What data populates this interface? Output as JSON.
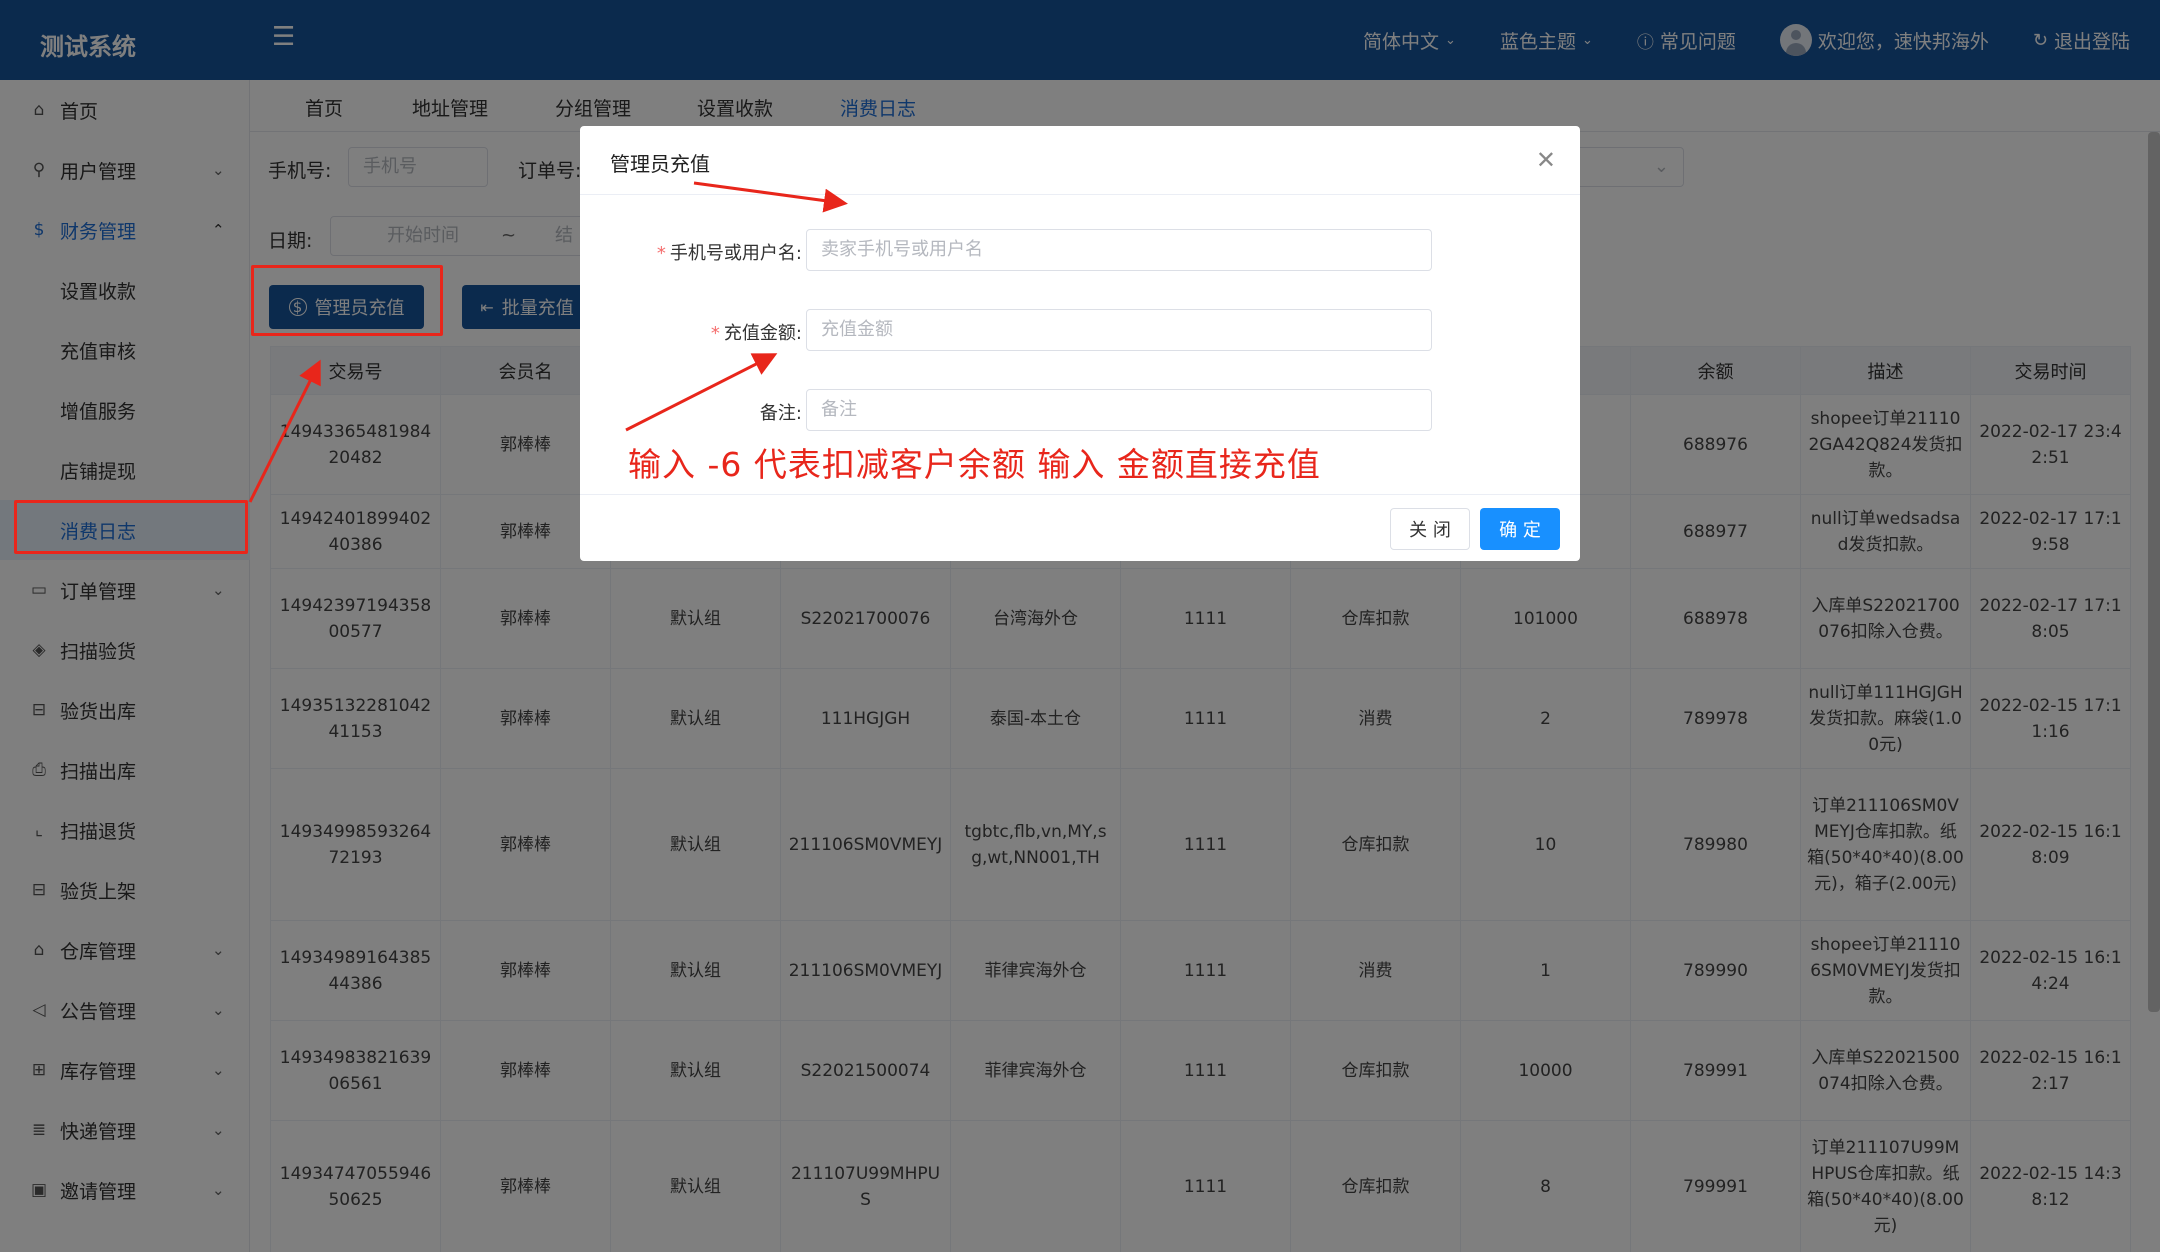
{
  "app": {
    "title": "测试系统"
  },
  "header": {
    "language": "简体中文",
    "theme": "蓝色主题",
    "faq": "常见问题",
    "welcome": "欢迎您，速快邦海外",
    "logout": "退出登陆"
  },
  "sidebar": {
    "items": [
      {
        "label": "首页",
        "icon": "home-icon"
      },
      {
        "label": "用户管理",
        "icon": "user-icon"
      },
      {
        "label": "财务管理",
        "icon": "dollar-icon"
      },
      {
        "label": "设置收款"
      },
      {
        "label": "充值审核"
      },
      {
        "label": "增值服务"
      },
      {
        "label": "店铺提现"
      },
      {
        "label": "消费日志"
      },
      {
        "label": "订单管理",
        "icon": "bag-icon"
      },
      {
        "label": "扫描验货",
        "icon": "shield-icon"
      },
      {
        "label": "验货出库",
        "icon": "scan-icon"
      },
      {
        "label": "扫描出库",
        "icon": "printer-icon"
      },
      {
        "label": "扫描退货",
        "icon": "return-icon"
      },
      {
        "label": "验货上架",
        "icon": "scan-icon"
      },
      {
        "label": "仓库管理",
        "icon": "bank-icon"
      },
      {
        "label": "公告管理",
        "icon": "megaphone-icon"
      },
      {
        "label": "库存管理",
        "icon": "grid-icon"
      },
      {
        "label": "快递管理",
        "icon": "list-icon"
      },
      {
        "label": "邀请管理",
        "icon": "ticket-icon"
      }
    ]
  },
  "tabs": [
    "首页",
    "地址管理",
    "分组管理",
    "设置收款",
    "消费日志"
  ],
  "filters": {
    "phone_label": "手机号:",
    "phone_placeholder": "手机号",
    "order_label": "订单号:",
    "date_label": "日期:",
    "date_start": "开始时间",
    "date_sep": "~",
    "date_end": "结"
  },
  "toolbar": {
    "admin_recharge": "管理员充值",
    "batch_recharge": "批量充值"
  },
  "table": {
    "headers": [
      "交易号",
      "会员名",
      "",
      "",
      "",
      "",
      "",
      "",
      "余额",
      "描述",
      "交易时间"
    ],
    "rows": [
      [
        "1494336548198420482",
        "郭棒棒",
        "",
        "",
        "",
        "",
        "",
        "",
        "688976",
        "shopee订单211102GA42Q824发货扣款。",
        "2022-02-17 23:42:51"
      ],
      [
        "1494240189940240386",
        "郭棒棒",
        "",
        "",
        "",
        "",
        "",
        "",
        "688977",
        "null订单wedsadsad发货扣款。",
        "2022-02-17 17:19:58"
      ],
      [
        "1494239719435800577",
        "郭棒棒",
        "默认组",
        "S22021700076",
        "台湾海外仓",
        "1111",
        "仓库扣款",
        "101000",
        "688978",
        "入库单S22021700076扣除入仓费。",
        "2022-02-17 17:18:05"
      ],
      [
        "1493513228104241153",
        "郭棒棒",
        "默认组",
        "111HGJGH",
        "泰国-本土仓",
        "1111",
        "消费",
        "2",
        "789978",
        "null订单111HGJGH发货扣款。麻袋(1.00元)",
        "2022-02-15 17:11:16"
      ],
      [
        "1493499859326472193",
        "郭棒棒",
        "默认组",
        "211106SM0VMEYJ",
        "tgbtc,flb,vn,MY,sg,wt,NN001,TH",
        "1111",
        "仓库扣款",
        "10",
        "789980",
        "订单211106SM0VMEYJ仓库扣款。纸箱(50*40*40)(8.00元)，箱子(2.00元)",
        "2022-02-15 16:18:09"
      ],
      [
        "1493498916438544386",
        "郭棒棒",
        "默认组",
        "211106SM0VMEYJ",
        "菲律宾海外仓",
        "1111",
        "消费",
        "1",
        "789990",
        "shopee订单211106SM0VMEYJ发货扣款。",
        "2022-02-15 16:14:24"
      ],
      [
        "1493498382163906561",
        "郭棒棒",
        "默认组",
        "S22021500074",
        "菲律宾海外仓",
        "1111",
        "仓库扣款",
        "10000",
        "789991",
        "入库单S22021500074扣除入仓费。",
        "2022-02-15 16:12:17"
      ],
      [
        "1493474705594650625",
        "郭棒棒",
        "默认组",
        "211107U99MHPUS",
        "",
        "1111",
        "仓库扣款",
        "8",
        "799991",
        "订单211107U99MHPUS仓库扣款。纸箱(50*40*40)(8.00元)",
        "2022-02-15 14:38:12"
      ]
    ]
  },
  "modal": {
    "title": "管理员充值",
    "account_label": "手机号或用户名:",
    "account_placeholder": "卖家手机号或用户名",
    "amount_label": "充值金额:",
    "amount_placeholder": "充值金额",
    "remark_label": "备注:",
    "remark_placeholder": "备注",
    "note": "输入 -6  代表扣减客户余额    输入 金额直接充值",
    "close_button": "关 闭",
    "ok_button": "确 定"
  },
  "colors": {
    "header_bg": "#17549b",
    "accent": "#1f6fd6",
    "primary_button": "#1890ff",
    "annotation": "#e8261b"
  }
}
